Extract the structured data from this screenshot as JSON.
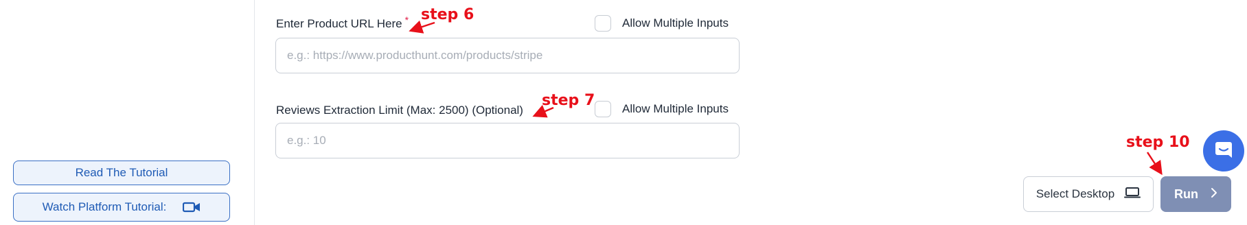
{
  "sidebar": {
    "read_tutorial_label": "Read The Tutorial",
    "watch_tutorial_label": "Watch Platform Tutorial:",
    "video_icon": "video-camera-icon"
  },
  "form": {
    "product_url": {
      "label": "Enter Product URL Here",
      "required_mark": "*",
      "placeholder": "e.g.: https://www.producthunt.com/products/stripe",
      "allow_multiple_label": "Allow Multiple Inputs",
      "allow_multiple_checked": false
    },
    "review_limit": {
      "label": "Reviews Extraction Limit (Max: 2500) (Optional)",
      "placeholder": "e.g.: 10",
      "allow_multiple_label": "Allow Multiple Inputs",
      "allow_multiple_checked": false
    }
  },
  "annotations": {
    "step6": "step 6",
    "step7": "step 7",
    "step10": "step 10",
    "color": "#e8101a"
  },
  "actions": {
    "select_desktop_label": "Select Desktop",
    "select_desktop_icon": "laptop-icon",
    "run_label": "Run",
    "run_icon": "chevron-right-icon",
    "run_color": "#7f8fb4"
  },
  "chat": {
    "icon": "chat-bubble-icon",
    "color": "#3b6fe6"
  }
}
